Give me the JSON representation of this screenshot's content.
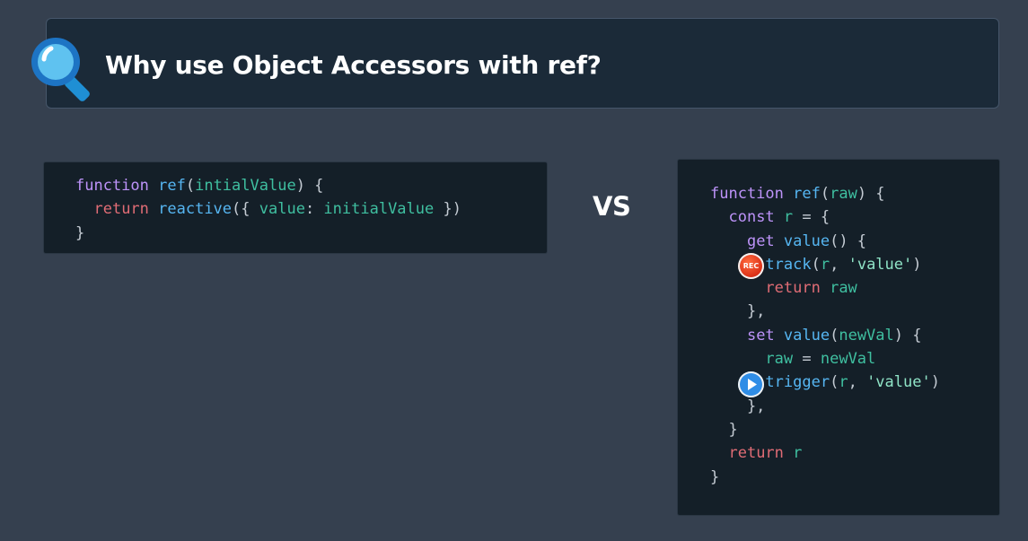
{
  "header": {
    "title": "Why use Object Accessors with ref?",
    "icon": "search-icon"
  },
  "vs_label": "VS",
  "badges": {
    "rec_label": "REC",
    "play_icon": "play-icon"
  },
  "left_code": [
    [
      [
        "kw",
        "function "
      ],
      [
        "fn",
        "ref"
      ],
      [
        "pn",
        "("
      ],
      [
        "id",
        "intialValue"
      ],
      [
        "pn",
        ") {"
      ]
    ],
    [
      [
        "pn",
        "  "
      ],
      [
        "kw2",
        "return "
      ],
      [
        "fn",
        "reactive"
      ],
      [
        "pn",
        "({ "
      ],
      [
        "id",
        "value"
      ],
      [
        "pn",
        ": "
      ],
      [
        "id",
        "initialValue"
      ],
      [
        "pn",
        " })"
      ]
    ],
    [
      [
        "pn",
        "}"
      ]
    ]
  ],
  "right_code": [
    [
      [
        "kw",
        "function "
      ],
      [
        "fn",
        "ref"
      ],
      [
        "pn",
        "("
      ],
      [
        "id",
        "raw"
      ],
      [
        "pn",
        ") {"
      ]
    ],
    [
      [
        "pn",
        "  "
      ],
      [
        "kw",
        "const "
      ],
      [
        "id",
        "r"
      ],
      [
        "pn",
        " = {"
      ]
    ],
    [
      [
        "pn",
        "    "
      ],
      [
        "kw",
        "get "
      ],
      [
        "fn",
        "value"
      ],
      [
        "pn",
        "() {"
      ]
    ],
    [
      [
        "pn",
        "      "
      ],
      [
        "fn",
        "track"
      ],
      [
        "pn",
        "("
      ],
      [
        "id",
        "r"
      ],
      [
        "pn",
        ", "
      ],
      [
        "str",
        "'value'"
      ],
      [
        "pn",
        ")"
      ]
    ],
    [
      [
        "pn",
        "      "
      ],
      [
        "kw2",
        "return "
      ],
      [
        "id",
        "raw"
      ]
    ],
    [
      [
        "pn",
        "    },"
      ]
    ],
    [
      [
        "pn",
        "    "
      ],
      [
        "kw",
        "set "
      ],
      [
        "fn",
        "value"
      ],
      [
        "pn",
        "("
      ],
      [
        "id",
        "newVal"
      ],
      [
        "pn",
        ") {"
      ]
    ],
    [
      [
        "pn",
        "      "
      ],
      [
        "id",
        "raw"
      ],
      [
        "pn",
        " = "
      ],
      [
        "id",
        "newVal"
      ]
    ],
    [
      [
        "pn",
        "      "
      ],
      [
        "fn",
        "trigger"
      ],
      [
        "pn",
        "("
      ],
      [
        "id",
        "r"
      ],
      [
        "pn",
        ", "
      ],
      [
        "str",
        "'value'"
      ],
      [
        "pn",
        ")"
      ]
    ],
    [
      [
        "pn",
        "    },"
      ]
    ],
    [
      [
        "pn",
        "  }"
      ]
    ],
    [
      [
        "pn",
        "  "
      ],
      [
        "kw2",
        "return "
      ],
      [
        "id",
        "r"
      ]
    ],
    [
      [
        "pn",
        "}"
      ]
    ]
  ]
}
